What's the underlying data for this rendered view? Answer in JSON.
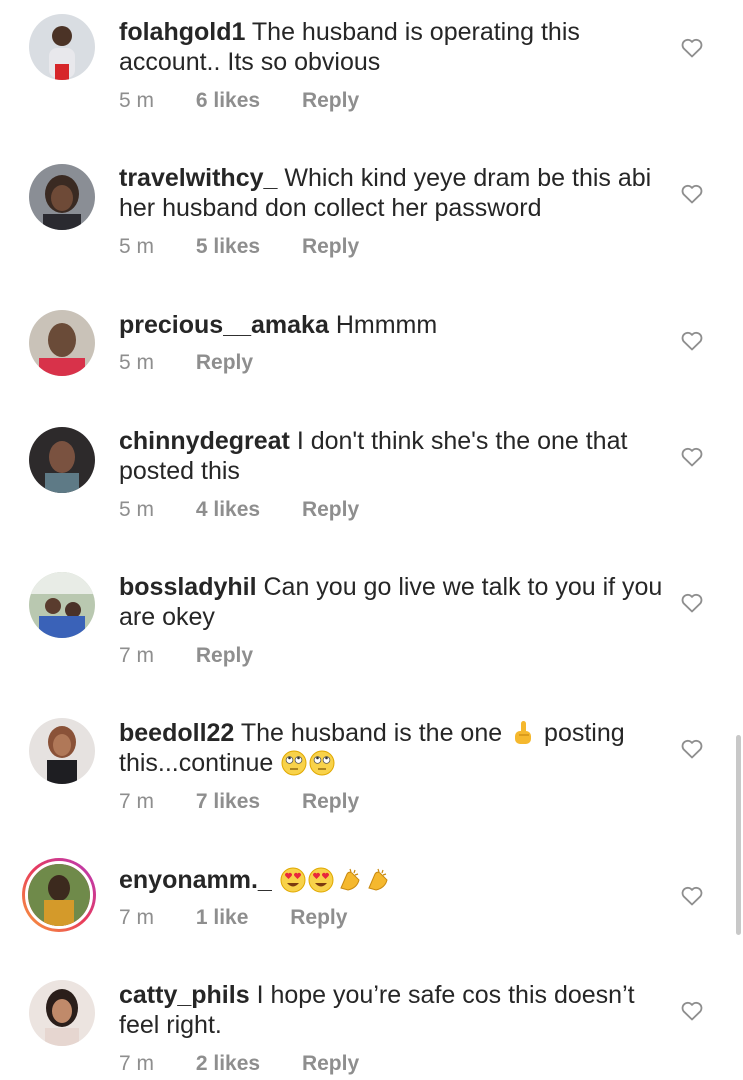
{
  "comments": [
    {
      "username": "folahgold1",
      "text": "The husband is operating this account.. Its so obvious",
      "time": "5 m",
      "likes": "6 likes",
      "reply": "Reply"
    },
    {
      "username": "travelwithcy_",
      "text": "Which kind yeye dram be this abi her husband don collect her password",
      "time": "5 m",
      "likes": "5 likes",
      "reply": "Reply"
    },
    {
      "username": "precious__amaka",
      "text": "Hmmmm",
      "time": "5 m",
      "likes": "",
      "reply": "Reply"
    },
    {
      "username": "chinnydegreat",
      "text": "I don't think she's the one that posted this",
      "time": "5 m",
      "likes": "4 likes",
      "reply": "Reply"
    },
    {
      "username": "bossladyhil",
      "text": "Can you go live we talk to you if you are okey",
      "time": "7 m",
      "likes": "",
      "reply": "Reply"
    },
    {
      "username": "beedoll22",
      "text_before": "The husband is the one",
      "text_middle": "posting this...continue",
      "time": "7 m",
      "likes": "7 likes",
      "reply": "Reply",
      "emojis": [
        "index-finger-up-emoji",
        "face-with-rolling-eyes-emoji",
        "face-with-rolling-eyes-emoji"
      ]
    },
    {
      "username": "enyonamm._",
      "time": "7 m",
      "likes": "1 like",
      "reply": "Reply",
      "emojis": [
        "heart-eyes-emoji",
        "heart-eyes-emoji",
        "clapping-hands-emoji",
        "clapping-hands-emoji"
      ]
    },
    {
      "username": "catty_phils",
      "text": "I hope you’re safe cos this doesn’t feel right.",
      "time": "7 m",
      "likes": "2 likes",
      "reply": "Reply"
    }
  ],
  "icons": {
    "like": "heart-outline-icon"
  },
  "colors": {
    "text": "#262626",
    "meta": "#8e8e8e",
    "story_ring_start": "#f9a13a",
    "story_ring_end": "#b43ac0"
  }
}
